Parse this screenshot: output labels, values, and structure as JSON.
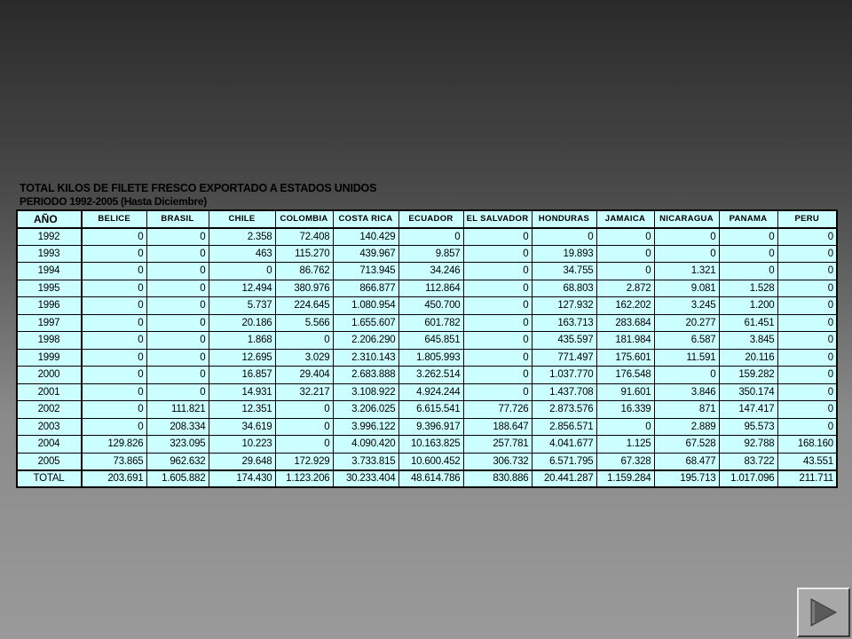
{
  "titles": {
    "line1": "TOTAL KILOS DE FILETE FRESCO EXPORTADO A ESTADOS UNIDOS",
    "line2": "PERIODO 1992-2005 (Hasta Diciembre)"
  },
  "table": {
    "headers": [
      "AÑO",
      "BELICE",
      "BRASIL",
      "CHILE",
      "COLOMBIA",
      "COSTA RICA",
      "ECUADOR",
      "EL SALVADOR",
      "HONDURAS",
      "JAMAICA",
      "NICARAGUA",
      "PANAMA",
      "PERU"
    ],
    "rows": [
      [
        "1992",
        "0",
        "0",
        "2.358",
        "72.408",
        "140.429",
        "0",
        "0",
        "0",
        "0",
        "0",
        "0",
        "0"
      ],
      [
        "1993",
        "0",
        "0",
        "463",
        "115.270",
        "439.967",
        "9.857",
        "0",
        "19.893",
        "0",
        "0",
        "0",
        "0"
      ],
      [
        "1994",
        "0",
        "0",
        "0",
        "86.762",
        "713.945",
        "34.246",
        "0",
        "34.755",
        "0",
        "1.321",
        "0",
        "0"
      ],
      [
        "1995",
        "0",
        "0",
        "12.494",
        "380.976",
        "866.877",
        "112.864",
        "0",
        "68.803",
        "2.872",
        "9.081",
        "1.528",
        "0"
      ],
      [
        "1996",
        "0",
        "0",
        "5.737",
        "224.645",
        "1.080.954",
        "450.700",
        "0",
        "127.932",
        "162.202",
        "3.245",
        "1.200",
        "0"
      ],
      [
        "1997",
        "0",
        "0",
        "20.186",
        "5.566",
        "1.655.607",
        "601.782",
        "0",
        "163.713",
        "283.684",
        "20.277",
        "61.451",
        "0"
      ],
      [
        "1998",
        "0",
        "0",
        "1.868",
        "0",
        "2.206.290",
        "645.851",
        "0",
        "435.597",
        "181.984",
        "6.587",
        "3.845",
        "0"
      ],
      [
        "1999",
        "0",
        "0",
        "12.695",
        "3.029",
        "2.310.143",
        "1.805.993",
        "0",
        "771.497",
        "175.601",
        "11.591",
        "20.116",
        "0"
      ],
      [
        "2000",
        "0",
        "0",
        "16.857",
        "29.404",
        "2.683.888",
        "3.262.514",
        "0",
        "1.037.770",
        "176.548",
        "0",
        "159.282",
        "0"
      ],
      [
        "2001",
        "0",
        "0",
        "14.931",
        "32.217",
        "3.108.922",
        "4.924.244",
        "0",
        "1.437.708",
        "91.601",
        "3.846",
        "350.174",
        "0"
      ],
      [
        "2002",
        "0",
        "111.821",
        "12.351",
        "0",
        "3.206.025",
        "6.615.541",
        "77.726",
        "2.873.576",
        "16.339",
        "871",
        "147.417",
        "0"
      ],
      [
        "2003",
        "0",
        "208.334",
        "34.619",
        "0",
        "3.996.122",
        "9.396.917",
        "188.647",
        "2.856.571",
        "0",
        "2.889",
        "95.573",
        "0"
      ],
      [
        "2004",
        "129.826",
        "323.095",
        "10.223",
        "0",
        "4.090.420",
        "10.163.825",
        "257.781",
        "4.041.677",
        "1.125",
        "67.528",
        "92.788",
        "168.160"
      ],
      [
        "2005",
        "73.865",
        "962.632",
        "29.648",
        "172.929",
        "3.733.815",
        "10.600.452",
        "306.732",
        "6.571.795",
        "67.328",
        "68.477",
        "83.722",
        "43.551"
      ]
    ],
    "total": [
      "TOTAL",
      "203.691",
      "1.605.882",
      "174.430",
      "1.123.206",
      "30.233.404",
      "48.614.786",
      "830.886",
      "20.441.287",
      "1.159.284",
      "195.713",
      "1.017.096",
      "211.711"
    ]
  },
  "colors": {
    "table_background": "#ccffff",
    "button_background": "#a8a8a8"
  },
  "icons": {
    "nav_button": "play-triangle-icon"
  }
}
